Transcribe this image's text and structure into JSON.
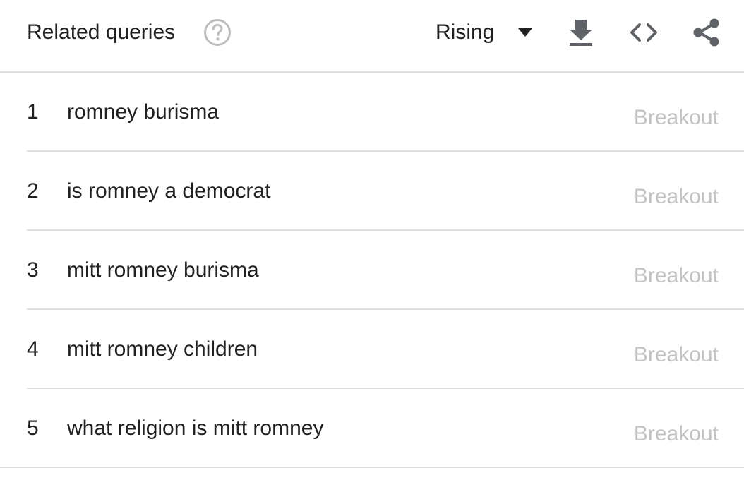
{
  "header": {
    "title": "Related queries",
    "help_icon": "help-circle-icon",
    "filter": {
      "selected": "Rising",
      "icon": "dropdown-triangle-icon"
    },
    "actions": {
      "download_icon": "download-icon",
      "embed_icon": "code-embed-icon",
      "share_icon": "share-icon"
    }
  },
  "rows": [
    {
      "rank": "1",
      "query": "romney burisma",
      "value": "Breakout"
    },
    {
      "rank": "2",
      "query": "is romney a democrat",
      "value": "Breakout"
    },
    {
      "rank": "3",
      "query": "mitt romney burisma",
      "value": "Breakout"
    },
    {
      "rank": "4",
      "query": "mitt romney children",
      "value": "Breakout"
    },
    {
      "rank": "5",
      "query": "what religion is mitt romney",
      "value": "Breakout"
    }
  ],
  "colors": {
    "text": "#212121",
    "muted": "#c2c2c2",
    "icon": "#5f6368",
    "divider": "#e0e0e0"
  }
}
